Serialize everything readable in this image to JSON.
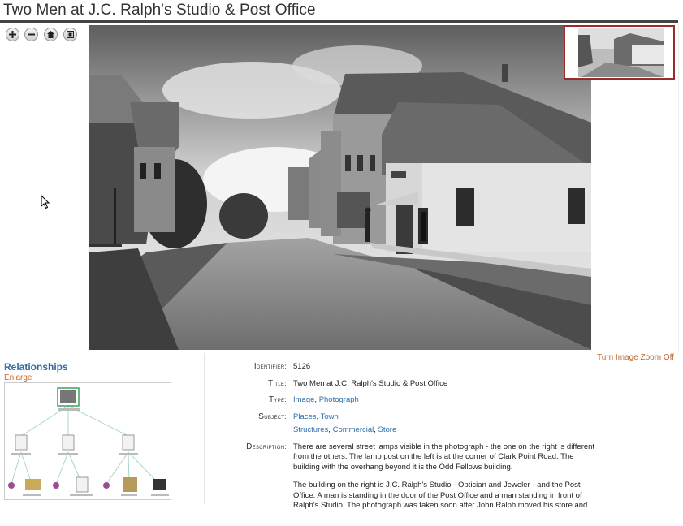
{
  "page": {
    "title": "Two Men at J.C. Ralph's Studio & Post Office"
  },
  "viewer": {
    "controls": [
      {
        "name": "zoom-in-button",
        "icon": "plus-icon"
      },
      {
        "name": "zoom-out-button",
        "icon": "minus-icon"
      },
      {
        "name": "home-button",
        "icon": "home-icon"
      },
      {
        "name": "fullscreen-button",
        "icon": "fullscreen-icon"
      }
    ],
    "zoom_toggle_label": "Turn Image Zoom Off"
  },
  "relationships": {
    "title": "Relationships",
    "enlarge_label": "Enlarge"
  },
  "metadata": {
    "identifier_label": "Identifier:",
    "identifier": "5126",
    "title_label": "Title:",
    "title": "Two Men at J.C. Ralph's Studio & Post Office",
    "type_label": "Type:",
    "type_links": [
      "Image",
      "Photograph"
    ],
    "subject_label": "Subject:",
    "subject_line1": [
      "Places",
      "Town"
    ],
    "subject_line2": [
      "Structures",
      "Commercial",
      "Store"
    ],
    "description_label": "Description:",
    "description_p1": "There are several street lamps visible in the photograph - the one on the right is different from the others. The lamp post on the left is at the corner of Clark Point Road. The building with the overhang beyond it is the Odd Fellows building.",
    "description_p2": "The building on the right is J.C. Ralph's Studio - Optician and Jeweler - and the Post Office. A man is standing in the door of the Post Office and a man standing in front of Ralph's Studio. The photograph was taken soon after John Ralph moved his store and"
  },
  "colors": {
    "link": "#2f6ea8",
    "accent_orange": "#c0682e",
    "thumb_border": "#9b2a2a"
  }
}
